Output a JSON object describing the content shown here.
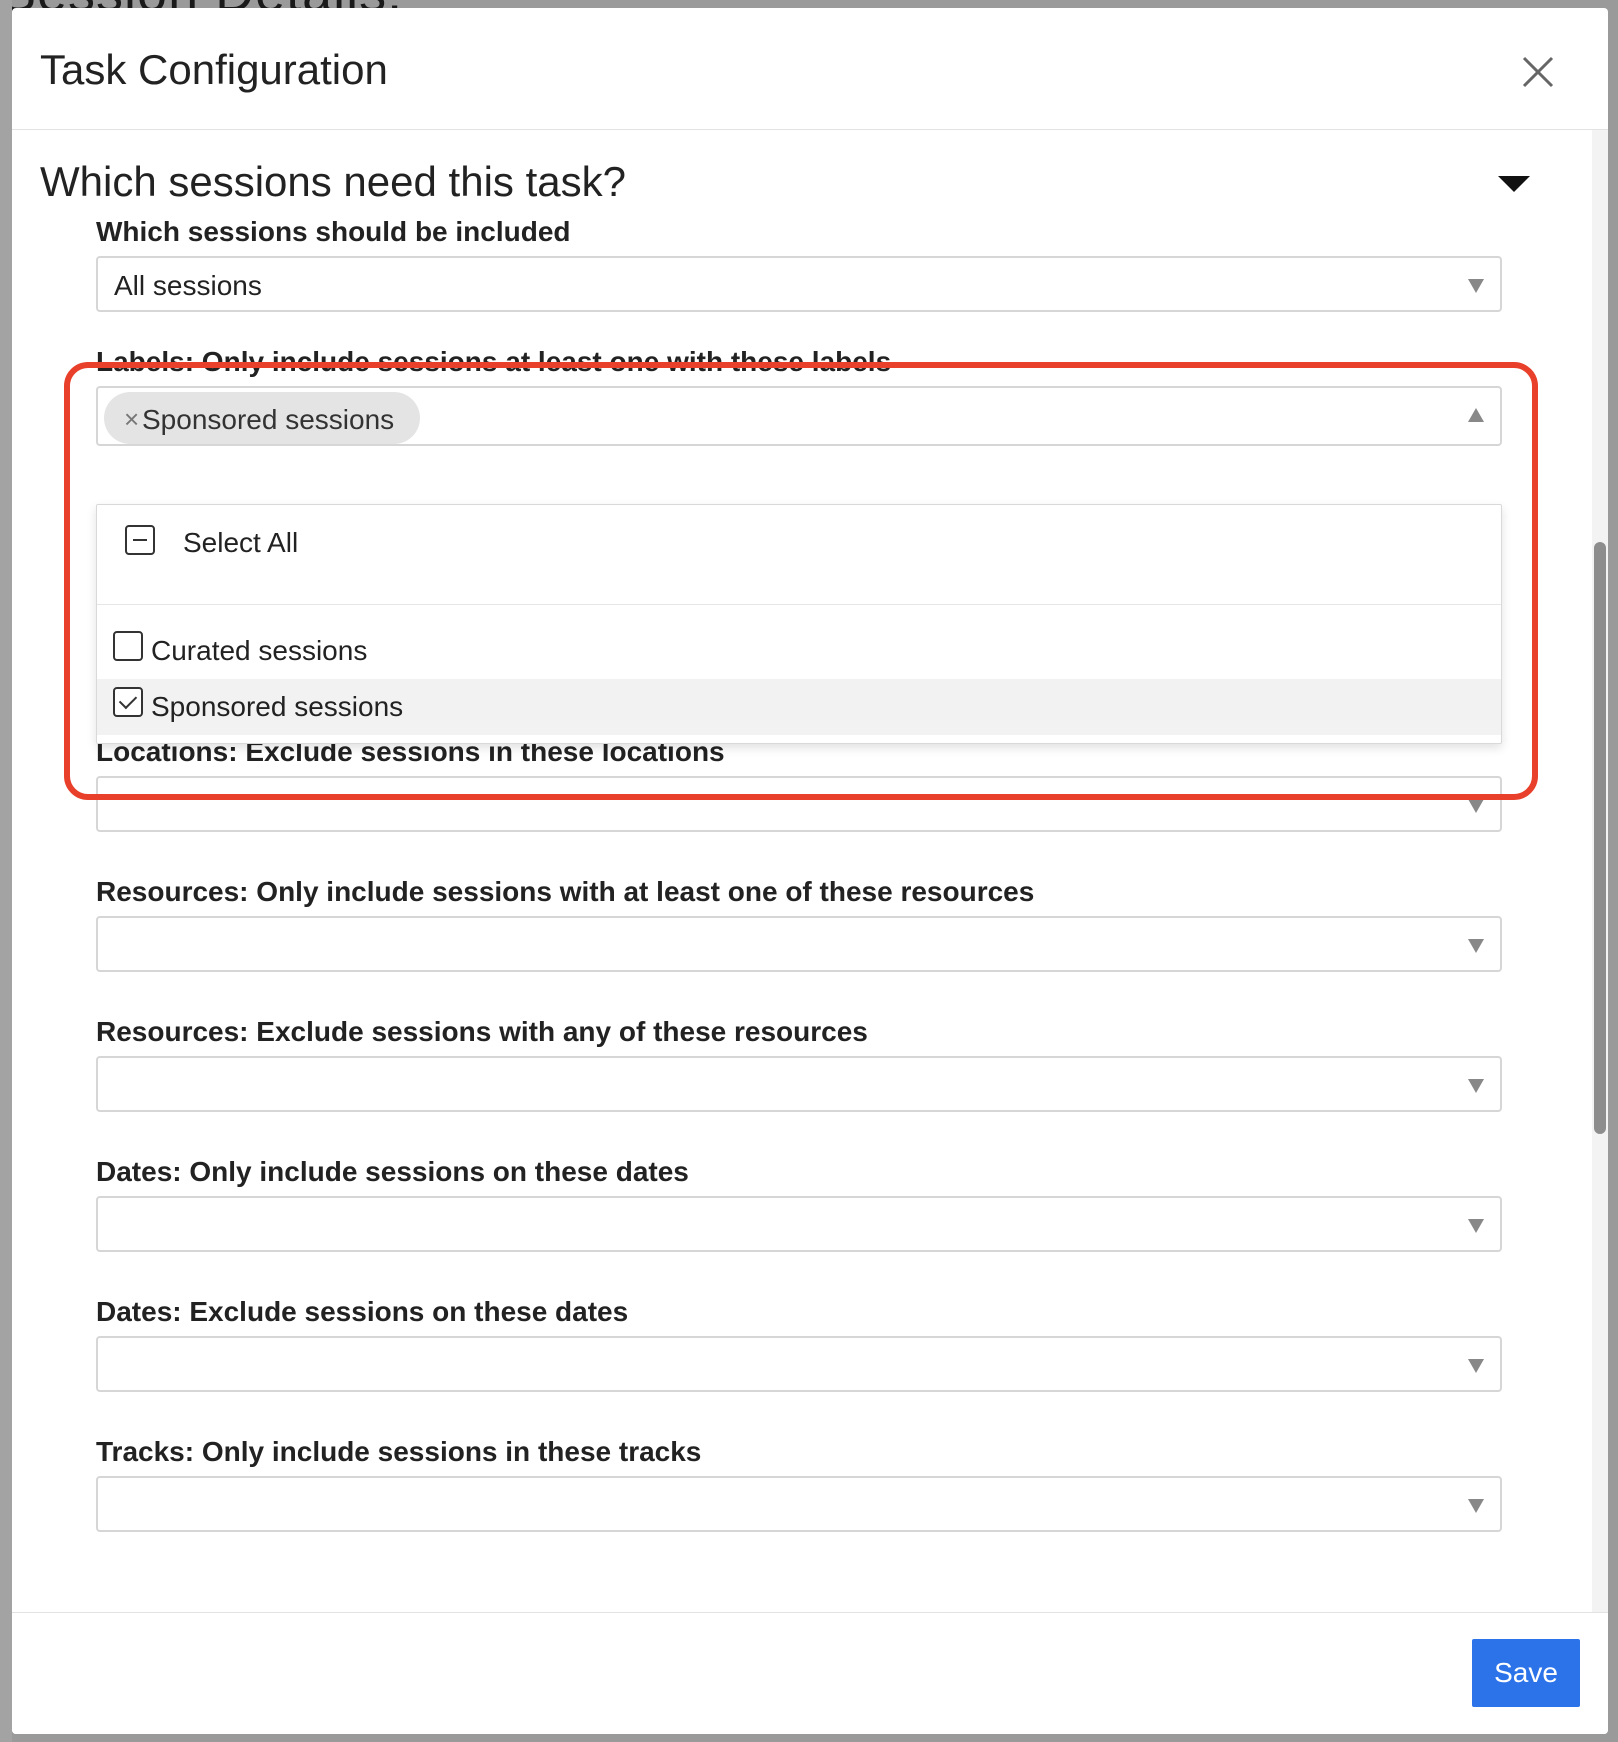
{
  "backdrop": {
    "title_fragment": "Session Details:"
  },
  "modal": {
    "title": "Task Configuration",
    "section_title": "Which sessions need this task?"
  },
  "fields": {
    "include": {
      "label": "Which sessions should be included",
      "value": "All sessions"
    },
    "labels": {
      "label": "Labels: Only include sessions at least one with these labels",
      "chip_remove": "×",
      "chip": "Sponsored sessions",
      "dropdown": {
        "select_all": "Select All",
        "options": [
          {
            "label": "Curated sessions",
            "checked": false
          },
          {
            "label": "Sponsored sessions",
            "checked": true
          }
        ]
      }
    },
    "locations_exclude": {
      "label": "Locations: Exclude sessions in these locations",
      "value": ""
    },
    "resources_include": {
      "label": "Resources: Only include sessions with at least one of these resources",
      "value": ""
    },
    "resources_exclude": {
      "label": "Resources: Exclude sessions with any of these resources",
      "value": ""
    },
    "dates_include": {
      "label": "Dates: Only include sessions on these dates",
      "value": ""
    },
    "dates_exclude": {
      "label": "Dates: Exclude sessions on these dates",
      "value": ""
    },
    "tracks_include": {
      "label": "Tracks: Only include sessions in these tracks",
      "value": ""
    }
  },
  "footer": {
    "save_label": "Save"
  },
  "colors": {
    "accent": "#2c73ea",
    "highlight": "#e8402a"
  }
}
